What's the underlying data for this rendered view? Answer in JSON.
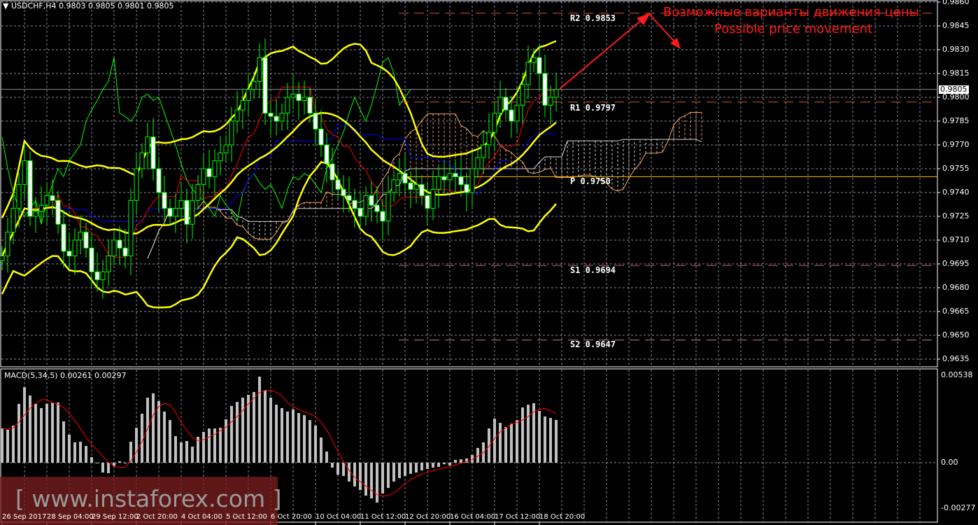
{
  "header": {
    "symbol": "USDCHF,H4",
    "ohlc": "0.9803 0.9805 0.9801 0.9805"
  },
  "current_price": "0.9805",
  "macd_label": "MACD(5,34,5) 0.00261 0.00297",
  "pivots": [
    {
      "name": "R2",
      "label": "R2 0.9853",
      "value": 0.9853,
      "color": "#e0502a"
    },
    {
      "name": "R1",
      "label": "R1 0.9797",
      "value": 0.9797,
      "color": "#e0502a"
    },
    {
      "name": "P",
      "label": "P 0.9750",
      "value": 0.975,
      "color": "#ffc000"
    },
    {
      "name": "S1",
      "label": "S1 0.9694",
      "value": 0.9694,
      "color": "#c86464"
    },
    {
      "name": "S2",
      "label": "S2 0.9647",
      "value": 0.9647,
      "color": "#c88080"
    }
  ],
  "annotation": {
    "line1": "Возможные варианты движения цены",
    "line2": "Possible price movement",
    "color": "#ff1a1a"
  },
  "watermark": "[ www.instaforex.com ]",
  "chart_data": [
    {
      "type": "candlestick",
      "title": "USDCHF,H4",
      "ylim": [
        0.9628,
        0.9862
      ],
      "y_ticks": [
        "0.9860",
        "0.9845",
        "0.9830",
        "0.9815",
        "0.9800",
        "0.9785",
        "0.9770",
        "0.9755",
        "0.9740",
        "0.9725",
        "0.9710",
        "0.9695",
        "0.9680",
        "0.9665",
        "0.9650",
        "0.9635"
      ],
      "x_ticks": [
        "26 Sep 2017",
        "28 Sep 04:00",
        "29 Sep 12:00",
        "2 Oct 20:00",
        "4 Oct 04:00",
        "5 Oct 12:00",
        "6 Oct 20:00",
        "10 Oct 04:00",
        "11 Oct 12:00",
        "12 Oct 20:00",
        "16 Oct 04:00",
        "17 Oct 12:00",
        "18 Oct 20:00"
      ],
      "close": [
        0.97,
        0.9715,
        0.973,
        0.9745,
        0.976,
        0.9725,
        0.9728,
        0.9732,
        0.9738,
        0.9735,
        0.972,
        0.9703,
        0.97,
        0.971,
        0.9715,
        0.9705,
        0.969,
        0.9685,
        0.969,
        0.97,
        0.971,
        0.9705,
        0.97,
        0.9735,
        0.9755,
        0.9765,
        0.9775,
        0.9755,
        0.974,
        0.973,
        0.9725,
        0.973,
        0.9735,
        0.972,
        0.9735,
        0.9745,
        0.9755,
        0.975,
        0.976,
        0.9765,
        0.977,
        0.9785,
        0.9792,
        0.9798,
        0.9805,
        0.981,
        0.9825,
        0.979,
        0.9788,
        0.9785,
        0.979,
        0.98,
        0.9802,
        0.9798,
        0.98,
        0.979,
        0.978,
        0.977,
        0.9758,
        0.9748,
        0.9742,
        0.9738,
        0.9735,
        0.973,
        0.9725,
        0.9738,
        0.9732,
        0.9728,
        0.9722,
        0.974,
        0.9748,
        0.9752,
        0.9746,
        0.9742,
        0.9745,
        0.9738,
        0.973,
        0.9742,
        0.975,
        0.9748,
        0.9752,
        0.975,
        0.9745,
        0.974,
        0.9755,
        0.9762,
        0.977,
        0.9778,
        0.979,
        0.98,
        0.9792,
        0.9785,
        0.9795,
        0.9808,
        0.9822,
        0.9825,
        0.9815,
        0.9795,
        0.98,
        0.9805
      ],
      "indicators": [
        "Bollinger Bands (20,2)",
        "Ichimoku",
        "Pivot levels"
      ],
      "colors": {
        "bollinger": "#ffff00",
        "tenkan": "#ff0000",
        "kijun": "#0000ff",
        "chikou": "#00ff00",
        "candle_outline": "#00ff00",
        "candle_body": "#ffffff",
        "senkou_a": "#f4a460",
        "senkou_b": "#d8d8d8"
      }
    },
    {
      "type": "bar",
      "title": "MACD(5,34,5)",
      "macd_value": 0.00261,
      "signal_value": 0.00297,
      "ylim": [
        -0.00277,
        0.00538
      ],
      "y_ticks": [
        "0.00538",
        "0.00",
        "-0.00277"
      ],
      "histogram": [
        0.00209,
        0.00201,
        0.00226,
        0.00359,
        0.00461,
        0.0041,
        0.00359,
        0.00333,
        0.00359,
        0.00367,
        0.00367,
        0.00252,
        0.00171,
        0.00124,
        0.00128,
        0.00102,
        0.00034,
        -4e-05,
        -0.0006,
        -0.00064,
        -0.0002,
        9e-05,
        -4e-05,
        0.00128,
        0.00213,
        0.00299,
        0.00397,
        0.00423,
        0.00376,
        0.00312,
        0.0026,
        0.00162,
        0.00124,
        0.00132,
        0.00098,
        0.00158,
        0.00188,
        0.00209,
        0.00209,
        0.00213,
        0.00265,
        0.00346,
        0.00371,
        0.00397,
        0.00414,
        0.00431,
        0.00525,
        0.0044,
        0.00397,
        0.00354,
        0.00333,
        0.00312,
        0.00325,
        0.00303,
        0.0029,
        0.0026,
        0.00226,
        0.00154,
        0.00068,
        -0.0003,
        -0.00073,
        -0.00081,
        -0.00115,
        -0.00145,
        -0.00167,
        -0.00201,
        -0.00218,
        -0.00243,
        -0.00188,
        -0.00154,
        -0.00115,
        -0.00094,
        -0.00081,
        -0.00068,
        -0.0006,
        -0.00047,
        -0.00038,
        -0.0003,
        -0.00026,
        -9e-05,
        -0.00017,
        0.00017,
        0.00021,
        0.00026,
        0.00047,
        0.0009,
        0.00124,
        0.00209,
        0.00269,
        0.00243,
        0.00218,
        0.00239,
        0.0026,
        0.00337,
        0.00354,
        0.00363,
        0.00316,
        0.00282,
        0.00273,
        0.00261
      ],
      "colors": {
        "histogram": "#c0c0c0",
        "signal": "#ff0000"
      }
    }
  ]
}
